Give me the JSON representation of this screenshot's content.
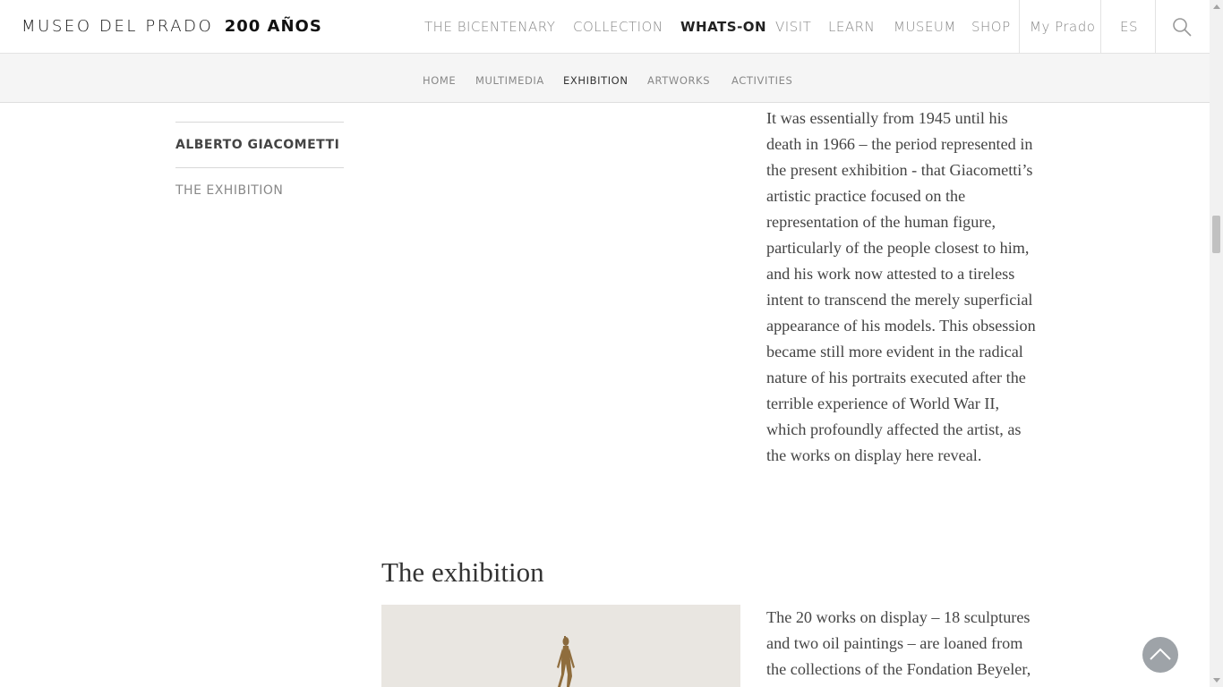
{
  "header": {
    "logo_text": "MUSEO DEL PRADO",
    "logo_bold": "200 AÑOS",
    "nav": [
      {
        "label": "THE BICENTENARY",
        "active": false
      },
      {
        "label": "COLLECTION",
        "active": false
      },
      {
        "label": "WHATS-ON",
        "active": true
      },
      {
        "label": "VISIT",
        "active": false
      },
      {
        "label": "LEARN",
        "active": false
      },
      {
        "label": "MUSEUM",
        "active": false
      },
      {
        "label": "SHOP",
        "active": false
      }
    ],
    "my_prado": "My Prado",
    "lang": "ES",
    "search_icon": "search-icon"
  },
  "subnav": [
    {
      "label": "HOME",
      "active": false
    },
    {
      "label": "MULTIMEDIA",
      "active": false
    },
    {
      "label": "EXHIBITION",
      "active": true
    },
    {
      "label": "ARTWORKS",
      "active": false
    },
    {
      "label": "ACTIVITIES",
      "active": false
    }
  ],
  "sidebar": {
    "items": [
      {
        "label": "ALBERTO GIACOMETTI"
      },
      {
        "label": "THE EXHIBITION"
      }
    ]
  },
  "content": {
    "paragraph1": "It was essentially from 1945 until his death in 1966 – the period represented in the present exhibition - that Giacometti’s artistic practice focused on the representation of the human figure, particularly of the people closest to him, and his work now attested to a tireless intent to transcend the merely superficial appearance of his models. This obsession became still more evident in the radical nature of his portraits executed after the terrible experience of World War II, which profoundly affected the artist, as the works on display here reveal.",
    "section_title": "The exhibition",
    "paragraph2": "The 20 works on display – 18 sculptures and two oil paintings – are loaned from the collections of the Fondation Beyeler,"
  },
  "colors": {
    "accent": "#222222",
    "muted": "#888888",
    "subnav_bg": "#f5f5f5",
    "back_to_top": "#9ea3a8"
  }
}
